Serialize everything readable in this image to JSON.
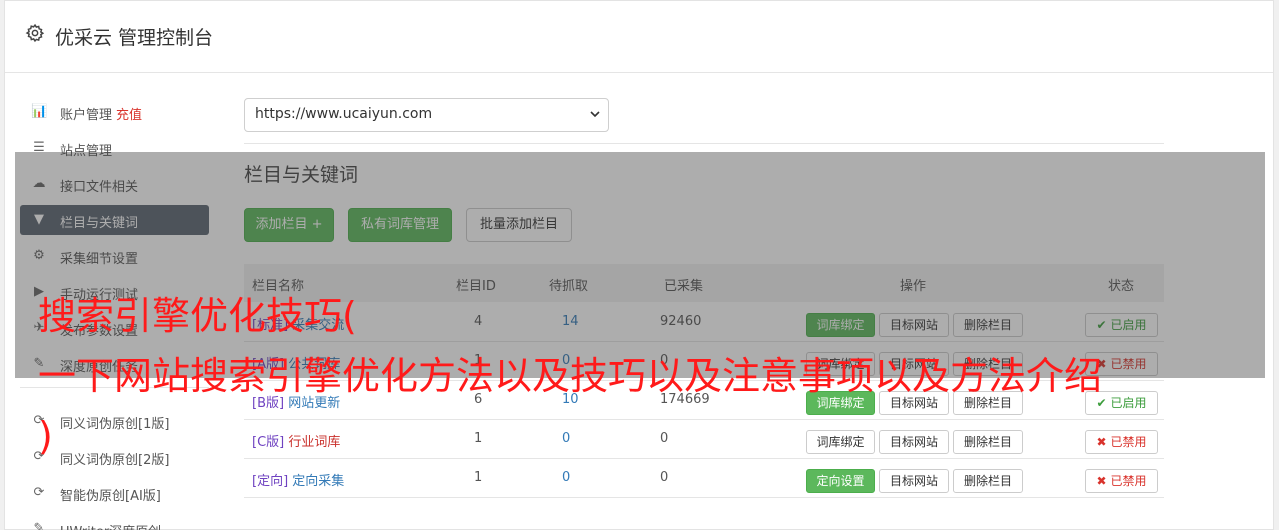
{
  "header": {
    "title": "优采云 管理控制台",
    "icon": "gear-icon"
  },
  "sidebar": {
    "items": [
      {
        "label": "账户管理",
        "extra": "充值",
        "icon": "bar-chart-icon",
        "glyph": "📊"
      },
      {
        "label": "站点管理",
        "icon": "server-icon",
        "glyph": "☰"
      },
      {
        "label": "接口文件相关",
        "icon": "cloud-upload-icon",
        "glyph": "☁"
      },
      {
        "label": "栏目与关键词",
        "icon": "filter-icon",
        "glyph": "▼",
        "active": true
      },
      {
        "label": "采集细节设置",
        "icon": "cogs-icon",
        "glyph": "⚙"
      },
      {
        "label": "手动运行测试",
        "icon": "play-icon",
        "glyph": "▶"
      },
      {
        "label": "发布参数设置",
        "icon": "send-icon",
        "glyph": "✈"
      },
      {
        "label": "深度原创任务",
        "icon": "edit-icon",
        "glyph": "✎"
      },
      {
        "label": "同义词伪原创[1版]",
        "icon": "refresh-icon",
        "glyph": "⟳"
      },
      {
        "label": "同义词伪原创[2版]",
        "icon": "refresh-icon",
        "glyph": "⟳"
      },
      {
        "label": "智能伪原创[AI版]",
        "icon": "refresh-icon",
        "glyph": "⟳"
      },
      {
        "label": "UWriter深度原创",
        "icon": "edit-icon",
        "glyph": "✎"
      }
    ]
  },
  "site_select": {
    "value": "https://www.ucaiyun.com"
  },
  "section": {
    "title": "栏目与关键词"
  },
  "toolbar": {
    "add_label": "添加栏目 +",
    "private_label": "私有词库管理",
    "batch_label": "批量添加栏目"
  },
  "table": {
    "headers": [
      "栏目名称",
      "栏目ID",
      "待抓取",
      "已采集",
      "操作",
      "状态"
    ],
    "rows": [
      {
        "tag": "[标准]",
        "name": "采集交流",
        "id": "4",
        "pending": "14",
        "collected": "92460",
        "bind": "词库绑定",
        "bind_green": true,
        "target": "目标网站",
        "delete": "删除栏目",
        "status": "已启用",
        "on": true
      },
      {
        "tag": "[A版]",
        "name": "公共词库",
        "id": "1",
        "pending": "0",
        "collected": "0",
        "bind": "词库绑定",
        "bind_green": false,
        "target": "目标网站",
        "delete": "删除栏目",
        "status": "已禁用",
        "on": false
      },
      {
        "tag": "[B版]",
        "name": "网站更新",
        "id": "6",
        "pending": "10",
        "collected": "174669",
        "bind": "词库绑定",
        "bind_green": true,
        "target": "目标网站",
        "delete": "删除栏目",
        "status": "已启用",
        "on": true
      },
      {
        "tag": "[C版]",
        "name": "行业词库",
        "id": "1",
        "pending": "0",
        "collected": "0",
        "bind": "词库绑定",
        "bind_green": false,
        "target": "目标网站",
        "delete": "删除栏目",
        "status": "已禁用",
        "on": false
      },
      {
        "tag": "[定向]",
        "name": "定向采集",
        "id": "1",
        "pending": "0",
        "collected": "0",
        "bind": "定向设置",
        "bind_green": true,
        "target": "目标网站",
        "delete": "删除栏目",
        "status": "已禁用",
        "on": false
      }
    ]
  },
  "overlay": {
    "line1": "搜索引擎优化技巧(",
    "line2": "一下网站搜索引擎优化方法以及技巧以及注意事项以及方法介绍",
    "line3": ")"
  },
  "colors": {
    "accent_green": "#5cb85c",
    "sidebar_active": "#5a6470",
    "overlay_text": "#ff1a1a",
    "link_blue": "#337ab7"
  }
}
